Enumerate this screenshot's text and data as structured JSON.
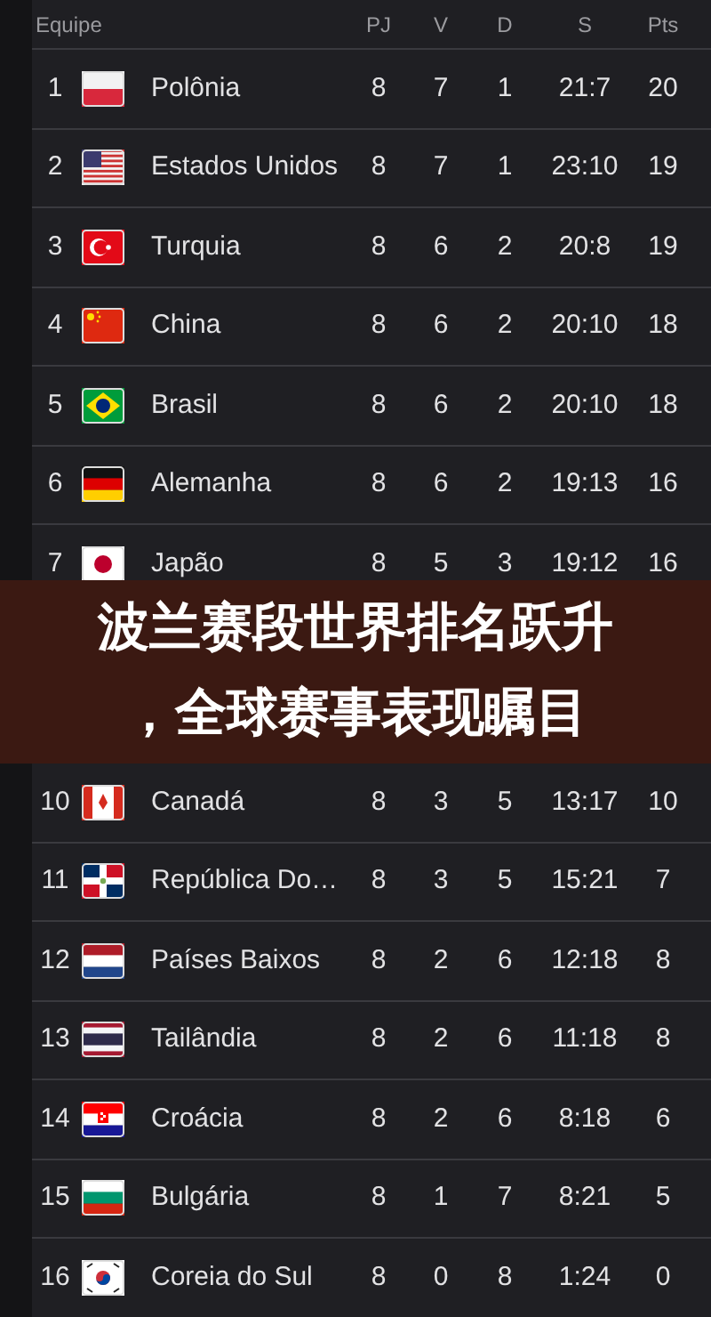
{
  "table": {
    "columns": [
      "Equipe",
      "PJ",
      "V",
      "D",
      "S",
      "Pts"
    ],
    "rows": [
      {
        "rank": "1",
        "team": "Polônia",
        "pj": "8",
        "v": "7",
        "d": "1",
        "s": "21:7",
        "pts": "20"
      },
      {
        "rank": "2",
        "team": "Estados Unidos",
        "pj": "8",
        "v": "7",
        "d": "1",
        "s": "23:10",
        "pts": "19"
      },
      {
        "rank": "3",
        "team": "Turquia",
        "pj": "8",
        "v": "6",
        "d": "2",
        "s": "20:8",
        "pts": "19"
      },
      {
        "rank": "4",
        "team": "China",
        "pj": "8",
        "v": "6",
        "d": "2",
        "s": "20:10",
        "pts": "18"
      },
      {
        "rank": "5",
        "team": "Brasil",
        "pj": "8",
        "v": "6",
        "d": "2",
        "s": "20:10",
        "pts": "18"
      },
      {
        "rank": "6",
        "team": "Alemanha",
        "pj": "8",
        "v": "6",
        "d": "2",
        "s": "19:13",
        "pts": "16"
      },
      {
        "rank": "7",
        "team": "Japão",
        "pj": "8",
        "v": "5",
        "d": "3",
        "s": "19:12",
        "pts": "16"
      },
      {
        "kind": "banner",
        "lines": [
          "波兰赛段世界排名跃升",
          "，全球赛事表现瞩目"
        ]
      },
      {
        "rank": "10",
        "team": "Canadá",
        "pj": "8",
        "v": "3",
        "d": "5",
        "s": "13:17",
        "pts": "10"
      },
      {
        "rank": "11",
        "team": "República Do…",
        "pj": "8",
        "v": "3",
        "d": "5",
        "s": "15:21",
        "pts": "7"
      },
      {
        "rank": "12",
        "team": "Países Baixos",
        "pj": "8",
        "v": "2",
        "d": "6",
        "s": "12:18",
        "pts": "8"
      },
      {
        "rank": "13",
        "team": "Tailândia",
        "pj": "8",
        "v": "2",
        "d": "6",
        "s": "11:18",
        "pts": "8"
      },
      {
        "rank": "14",
        "team": "Croácia",
        "pj": "8",
        "v": "2",
        "d": "6",
        "s": "8:18",
        "pts": "6"
      },
      {
        "rank": "15",
        "team": "Bulgária",
        "pj": "8",
        "v": "1",
        "d": "7",
        "s": "8:21",
        "pts": "5"
      },
      {
        "rank": "16",
        "team": "Coreia do Sul",
        "pj": "8",
        "v": "0",
        "d": "8",
        "s": "1:24",
        "pts": "0"
      }
    ]
  }
}
